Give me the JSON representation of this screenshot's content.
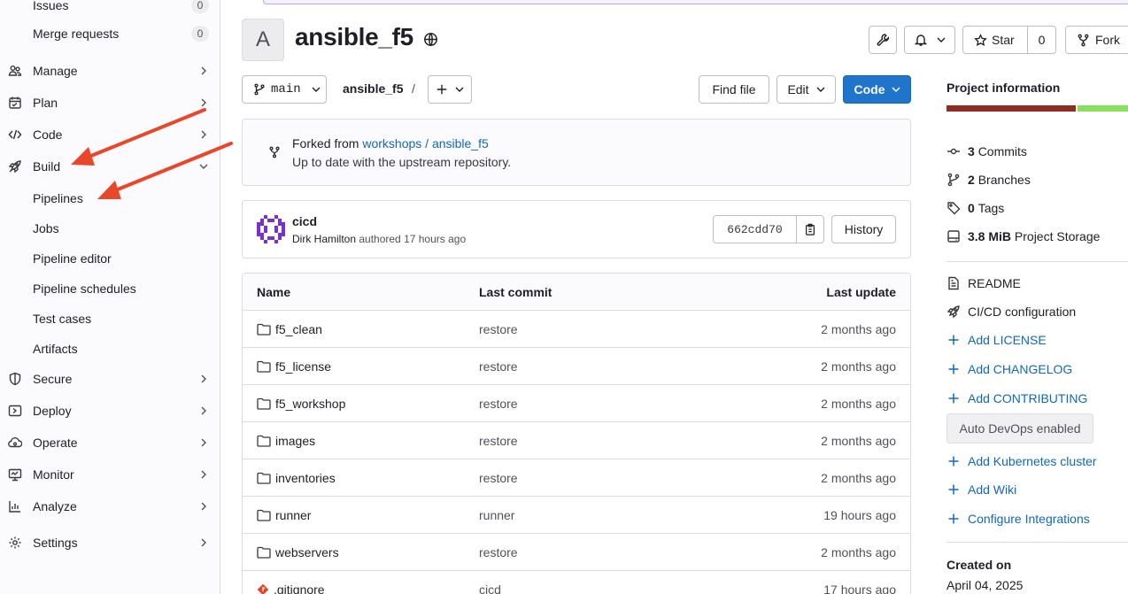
{
  "sidebar": {
    "issues": {
      "label": "Issues",
      "count": "0"
    },
    "merge_requests": {
      "label": "Merge requests",
      "count": "0"
    },
    "manage": "Manage",
    "plan": "Plan",
    "code": "Code",
    "build": "Build",
    "build_items": [
      "Pipelines",
      "Jobs",
      "Pipeline editor",
      "Pipeline schedules",
      "Test cases",
      "Artifacts"
    ],
    "secure": "Secure",
    "deploy": "Deploy",
    "operate": "Operate",
    "monitor": "Monitor",
    "analyze": "Analyze",
    "settings": "Settings"
  },
  "header": {
    "avatar_letter": "A",
    "title": "ansible_f5",
    "star_label": "Star",
    "star_count": "0",
    "fork_label": "Fork"
  },
  "toolbar": {
    "branch": "main",
    "breadcrumb_repo": "ansible_f5",
    "breadcrumb_sep": "/",
    "find_file": "Find file",
    "edit": "Edit",
    "code": "Code"
  },
  "fork_info": {
    "prefix": "Forked from",
    "source": "workshops / ansible_f5",
    "status": "Up to date with the upstream repository."
  },
  "last_commit": {
    "title": "cicd",
    "author": "Dirk Hamilton",
    "meta": "authored 17 hours ago",
    "sha": "662cdd70",
    "history_label": "History"
  },
  "table": {
    "headers": [
      "Name",
      "Last commit",
      "Last update"
    ],
    "rows": [
      {
        "name": "f5_clean",
        "commit": "restore",
        "updated": "2 months ago",
        "type": "folder"
      },
      {
        "name": "f5_license",
        "commit": "restore",
        "updated": "2 months ago",
        "type": "folder"
      },
      {
        "name": "f5_workshop",
        "commit": "restore",
        "updated": "2 months ago",
        "type": "folder"
      },
      {
        "name": "images",
        "commit": "restore",
        "updated": "2 months ago",
        "type": "folder"
      },
      {
        "name": "inventories",
        "commit": "restore",
        "updated": "2 months ago",
        "type": "folder"
      },
      {
        "name": "runner",
        "commit": "runner",
        "updated": "19 hours ago",
        "type": "folder"
      },
      {
        "name": "webservers",
        "commit": "restore",
        "updated": "2 months ago",
        "type": "folder"
      },
      {
        "name": ".gitignore",
        "commit": "cicd",
        "updated": "17 hours ago",
        "type": "file"
      }
    ]
  },
  "project_info": {
    "heading": "Project information",
    "commits": {
      "count": "3",
      "label": "Commits"
    },
    "branches": {
      "count": "2",
      "label": "Branches"
    },
    "tags": {
      "count": "0",
      "label": "Tags"
    },
    "storage": {
      "count": "3.8 MiB",
      "label": "Project Storage"
    },
    "readme": "README",
    "cicd": "CI/CD configuration",
    "add_license": "Add LICENSE",
    "add_changelog": "Add CHANGELOG",
    "add_contributing": "Add CONTRIBUTING",
    "auto_devops": "Auto DevOps enabled",
    "add_k8s": "Add Kubernetes cluster",
    "add_wiki": "Add Wiki",
    "configure_integrations": "Configure Integrations",
    "created_on_label": "Created on",
    "created_on": "April 04, 2025"
  },
  "colors": {
    "accent": "#1f75cb",
    "link": "#1068bf",
    "annotation_arrow": "#e8472a",
    "language_bar_1": "#8e2e20",
    "language_bar_2": "#86e05a"
  }
}
